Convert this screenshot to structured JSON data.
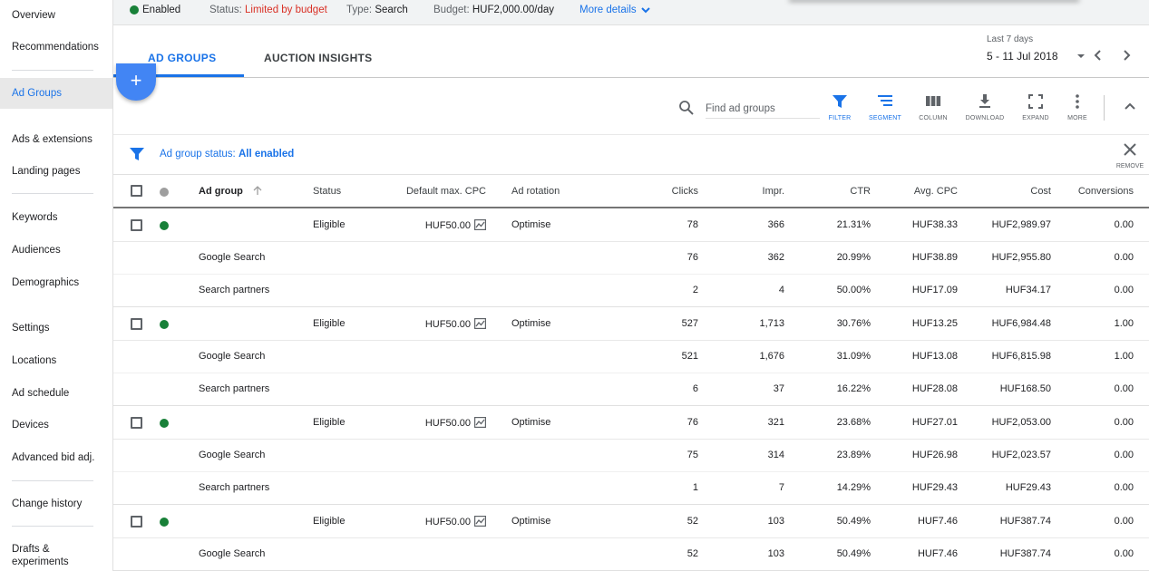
{
  "sidebar": {
    "items": [
      {
        "label": "Overview"
      },
      {
        "label": "Recommendations"
      },
      {
        "label": "Ad Groups",
        "active": true
      },
      {
        "label": "Ads & extensions"
      },
      {
        "label": "Landing pages"
      },
      {
        "label": "Keywords"
      },
      {
        "label": "Audiences"
      },
      {
        "label": "Demographics"
      },
      {
        "label": "Settings"
      },
      {
        "label": "Locations"
      },
      {
        "label": "Ad schedule"
      },
      {
        "label": "Devices"
      },
      {
        "label": "Advanced bid adj."
      },
      {
        "label": "Change history"
      },
      {
        "label": "Drafts & experiments"
      }
    ]
  },
  "statusbar": {
    "enabled": "Enabled",
    "status_label": "Status:",
    "status_value": "Limited by budget",
    "type_label": "Type:",
    "type_value": "Search",
    "budget_label": "Budget:",
    "budget_value": "HUF2,000.00/day",
    "more_details": "More details"
  },
  "tabs": {
    "ad_groups": "AD GROUPS",
    "auction_insights": "AUCTION INSIGHTS"
  },
  "date": {
    "label": "Last 7 days",
    "range": "5 - 11 Jul 2018"
  },
  "fab": {
    "label": "+"
  },
  "toolbar": {
    "search_placeholder": "Find ad groups",
    "filter": "FILTER",
    "segment": "SEGMENT",
    "column": "COLUMN",
    "download": "DOWNLOAD",
    "expand": "EXPAND",
    "more": "MORE"
  },
  "filter": {
    "label": "Ad group status:",
    "value": "All enabled",
    "remove": "REMOVE"
  },
  "table": {
    "headers": {
      "ad_group": "Ad group",
      "status": "Status",
      "default_max_cpc": "Default max. CPC",
      "ad_rotation": "Ad rotation",
      "clicks": "Clicks",
      "impr": "Impr.",
      "ctr": "CTR",
      "avg_cpc": "Avg. CPC",
      "cost": "Cost",
      "conversions": "Conversions"
    },
    "groups": [
      {
        "status": "Eligible",
        "cpc": "HUF50.00",
        "rotation": "Optimise",
        "clicks": "78",
        "impr": "366",
        "ctr": "21.31%",
        "avg_cpc": "HUF38.33",
        "cost": "HUF2,989.97",
        "conversions": "0.00",
        "subs": [
          {
            "name": "Google Search",
            "clicks": "76",
            "impr": "362",
            "ctr": "20.99%",
            "avg_cpc": "HUF38.89",
            "cost": "HUF2,955.80",
            "conversions": "0.00"
          },
          {
            "name": "Search partners",
            "clicks": "2",
            "impr": "4",
            "ctr": "50.00%",
            "avg_cpc": "HUF17.09",
            "cost": "HUF34.17",
            "conversions": "0.00"
          }
        ]
      },
      {
        "status": "Eligible",
        "cpc": "HUF50.00",
        "rotation": "Optimise",
        "clicks": "527",
        "impr": "1,713",
        "ctr": "30.76%",
        "avg_cpc": "HUF13.25",
        "cost": "HUF6,984.48",
        "conversions": "1.00",
        "subs": [
          {
            "name": "Google Search",
            "clicks": "521",
            "impr": "1,676",
            "ctr": "31.09%",
            "avg_cpc": "HUF13.08",
            "cost": "HUF6,815.98",
            "conversions": "1.00"
          },
          {
            "name": "Search partners",
            "clicks": "6",
            "impr": "37",
            "ctr": "16.22%",
            "avg_cpc": "HUF28.08",
            "cost": "HUF168.50",
            "conversions": "0.00"
          }
        ]
      },
      {
        "status": "Eligible",
        "cpc": "HUF50.00",
        "rotation": "Optimise",
        "clicks": "76",
        "impr": "321",
        "ctr": "23.68%",
        "avg_cpc": "HUF27.01",
        "cost": "HUF2,053.00",
        "conversions": "0.00",
        "subs": [
          {
            "name": "Google Search",
            "clicks": "75",
            "impr": "314",
            "ctr": "23.89%",
            "avg_cpc": "HUF26.98",
            "cost": "HUF2,023.57",
            "conversions": "0.00"
          },
          {
            "name": "Search partners",
            "clicks": "1",
            "impr": "7",
            "ctr": "14.29%",
            "avg_cpc": "HUF29.43",
            "cost": "HUF29.43",
            "conversions": "0.00"
          }
        ]
      },
      {
        "status": "Eligible",
        "cpc": "HUF50.00",
        "rotation": "Optimise",
        "clicks": "52",
        "impr": "103",
        "ctr": "50.49%",
        "avg_cpc": "HUF7.46",
        "cost": "HUF387.74",
        "conversions": "0.00",
        "subs": [
          {
            "name": "Google Search",
            "clicks": "52",
            "impr": "103",
            "ctr": "50.49%",
            "avg_cpc": "HUF7.46",
            "cost": "HUF387.74",
            "conversions": "0.00"
          }
        ]
      }
    ]
  },
  "colors": {
    "accent": "#1a73e8",
    "fab": "#4285f4",
    "enabled_green": "#188038",
    "warning_red": "#d93025"
  }
}
